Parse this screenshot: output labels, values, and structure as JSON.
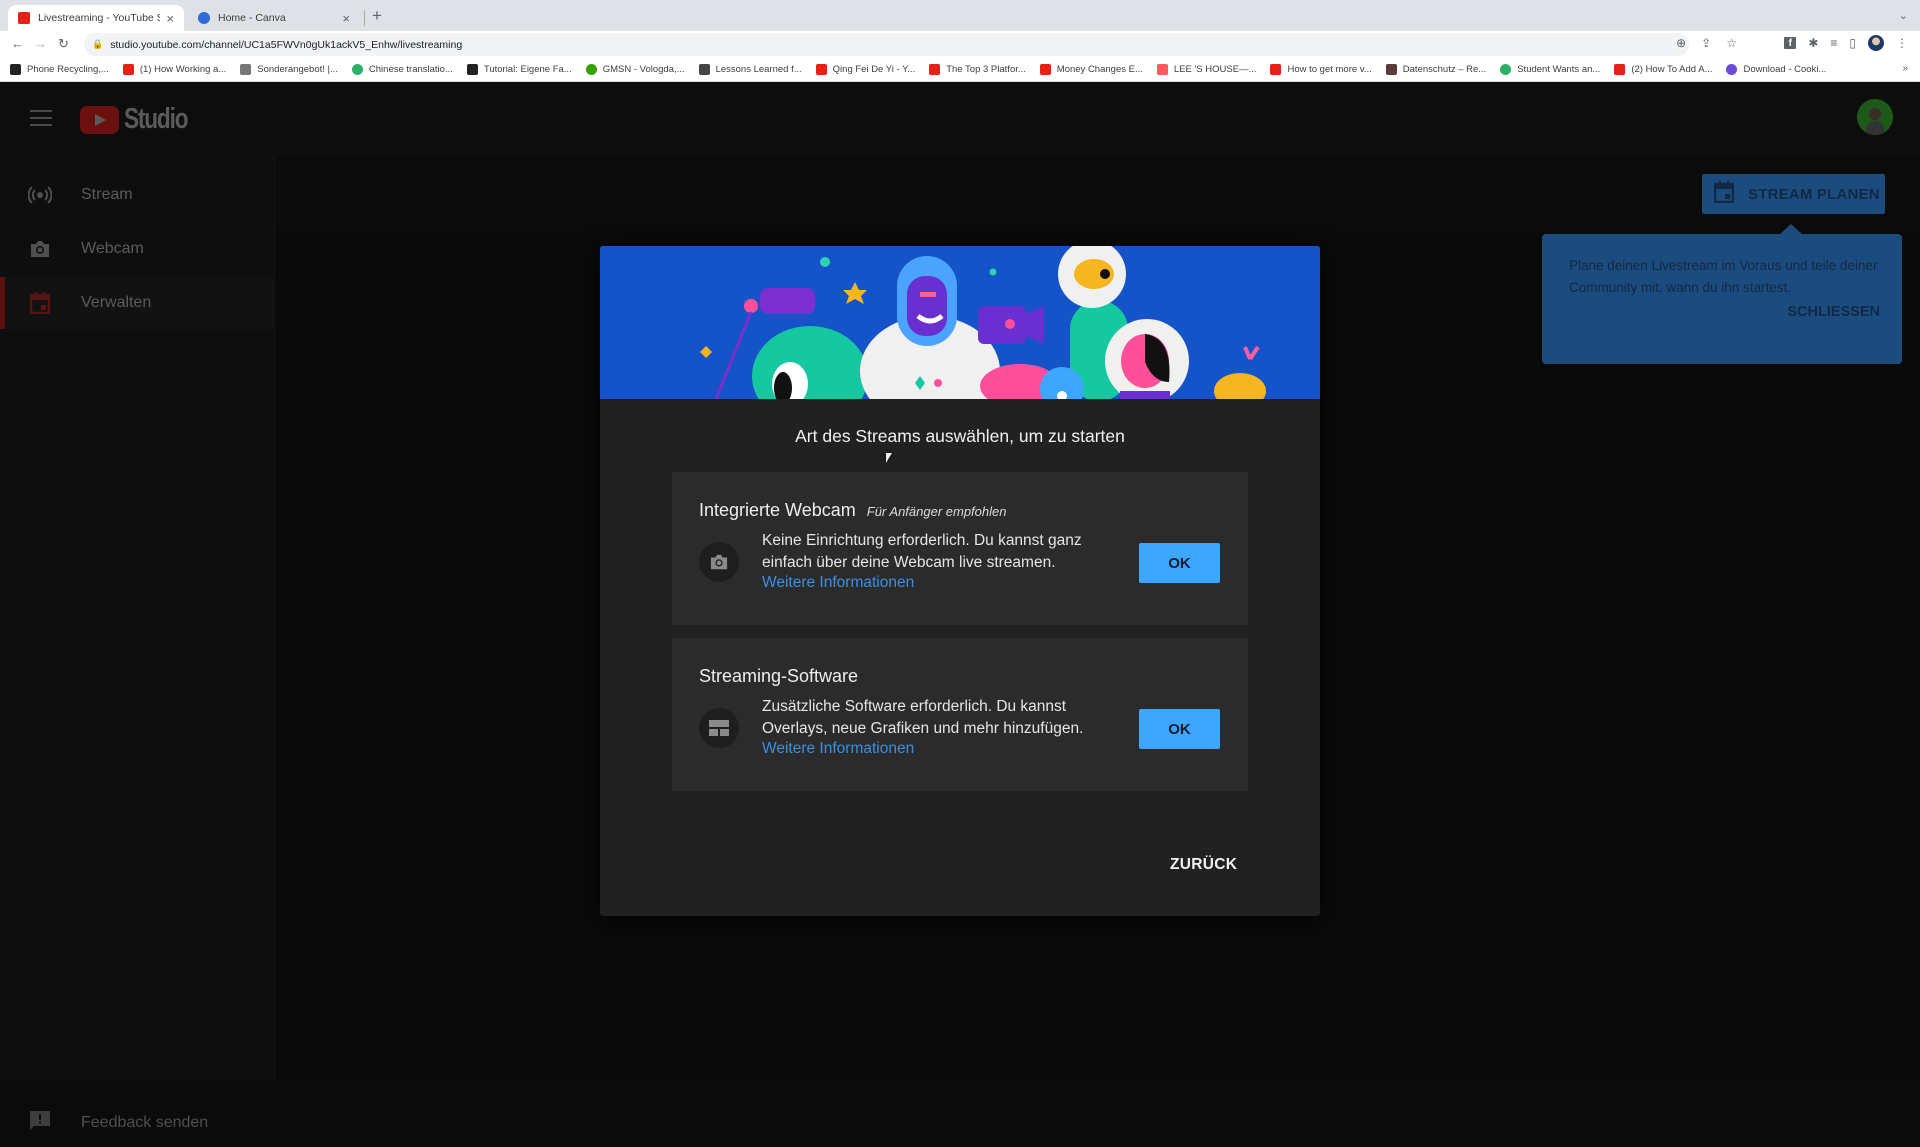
{
  "browser": {
    "tabs": [
      {
        "title": "Livestreaming - YouTube Studio",
        "active": true,
        "favicon": "youtube-icon"
      },
      {
        "title": "Home - Canva",
        "active": false,
        "favicon": "canva-icon"
      }
    ],
    "new_tab_label": "+",
    "url": "studio.youtube.com/channel/UC1a5FWVn0gUk1ackV5_Enhw/livestreaming",
    "bookmarks": [
      {
        "label": "Phone Recycling,...",
        "icon": "o2-icon",
        "color": "#222222"
      },
      {
        "label": "(1) How Working a...",
        "icon": "youtube-icon",
        "color": "#e62117"
      },
      {
        "label": "Sonderangebot! |...",
        "icon": "check-icon",
        "color": "#777777"
      },
      {
        "label": "Chinese translatio...",
        "icon": "green-circle-icon",
        "color": "#2fae6a"
      },
      {
        "label": "Tutorial: Eigene Fa...",
        "icon": "hash-icon",
        "color": "#222222"
      },
      {
        "label": "GMSN - Vologda,...",
        "icon": "upwork-icon",
        "color": "#37a000"
      },
      {
        "label": "Lessons Learned f...",
        "icon": "eir-icon",
        "color": "#444444"
      },
      {
        "label": "Qing Fei De Yi - Y...",
        "icon": "youtube-icon",
        "color": "#e62117"
      },
      {
        "label": "The Top 3 Platfor...",
        "icon": "youtube-icon",
        "color": "#e62117"
      },
      {
        "label": "Money Changes E...",
        "icon": "youtube-icon",
        "color": "#e62117"
      },
      {
        "label": "LEE 'S HOUSE—...",
        "icon": "airbnb-icon",
        "color": "#ff5a5f"
      },
      {
        "label": "How to get more v...",
        "icon": "youtube-icon",
        "color": "#e62117"
      },
      {
        "label": "Datenschutz – Re...",
        "icon": "image-icon",
        "color": "#5a3a3a"
      },
      {
        "label": "Student Wants an...",
        "icon": "green-circle-icon",
        "color": "#2fae6a"
      },
      {
        "label": "(2) How To Add A...",
        "icon": "youtube-icon",
        "color": "#e62117"
      },
      {
        "label": "Download - Cooki...",
        "icon": "ring-icon",
        "color": "#6a4cd6"
      }
    ],
    "bookmarks_overflow": "»"
  },
  "app": {
    "logo_text": "Studio",
    "sidebar": {
      "items": [
        {
          "label": "Stream",
          "icon": "broadcast-icon",
          "active": false
        },
        {
          "label": "Webcam",
          "icon": "camera-icon",
          "active": false
        },
        {
          "label": "Verwalten",
          "icon": "calendar-icon",
          "active": true
        }
      ],
      "feedback_label": "Feedback senden"
    },
    "schedule_button_label": "STREAM PLANEN",
    "tooltip": {
      "text": "Plane deinen Livestream im Voraus und teile deiner Community mit, wann du ihn startest.",
      "close_label": "SCHLIESSEN"
    }
  },
  "dialog": {
    "title": "Art des Streams auswählen, um zu starten",
    "options": [
      {
        "title": "Integrierte Webcam",
        "badge": "Für Anfänger empfohlen",
        "description": "Keine Einrichtung erforderlich. Du kannst ganz einfach über deine Webcam live streamen.",
        "link": "Weitere Informationen",
        "button": "OK",
        "icon": "camera-icon"
      },
      {
        "title": "Streaming-Software",
        "badge": "",
        "description": "Zusätzliche Software erforderlich. Du kannst Overlays, neue Grafiken und mehr hinzufügen.",
        "link": "Weitere Informationen",
        "button": "OK",
        "icon": "layout-icon"
      }
    ],
    "back_label": "ZURÜCK"
  },
  "colors": {
    "primary_blue": "#3ea6ff",
    "link_blue": "#3d8fe0",
    "banner_blue": "#1553c9",
    "dimmed_accent_red": "#5a1010"
  }
}
